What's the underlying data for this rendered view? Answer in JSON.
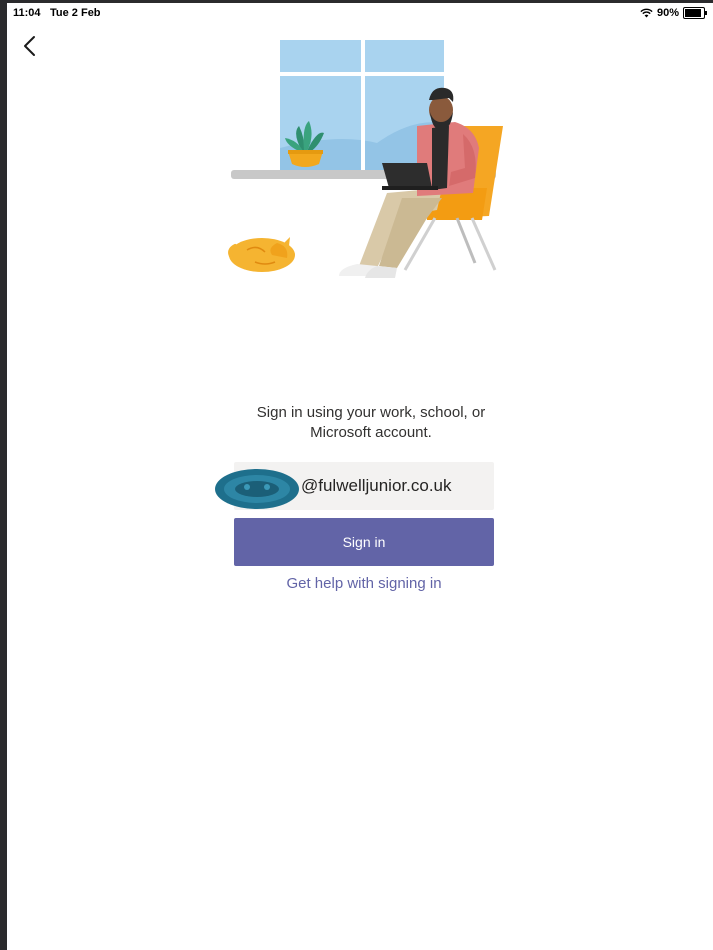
{
  "status_bar": {
    "time": "11:04",
    "date": "Tue 2 Feb",
    "battery": "90%",
    "battery_level": 0.9
  },
  "nav": {
    "back_icon": "chevron-left-icon"
  },
  "signin": {
    "prompt": "Sign in using your work, school, or\nMicrosoft account.",
    "email_domain": "@fulwelljunior.co.uk",
    "button_label": "Sign in",
    "help_link": "Get help with signing in"
  },
  "colors": {
    "accent": "#6264a7",
    "field_bg": "#f3f2f1",
    "redaction": "#1e6f8c"
  }
}
